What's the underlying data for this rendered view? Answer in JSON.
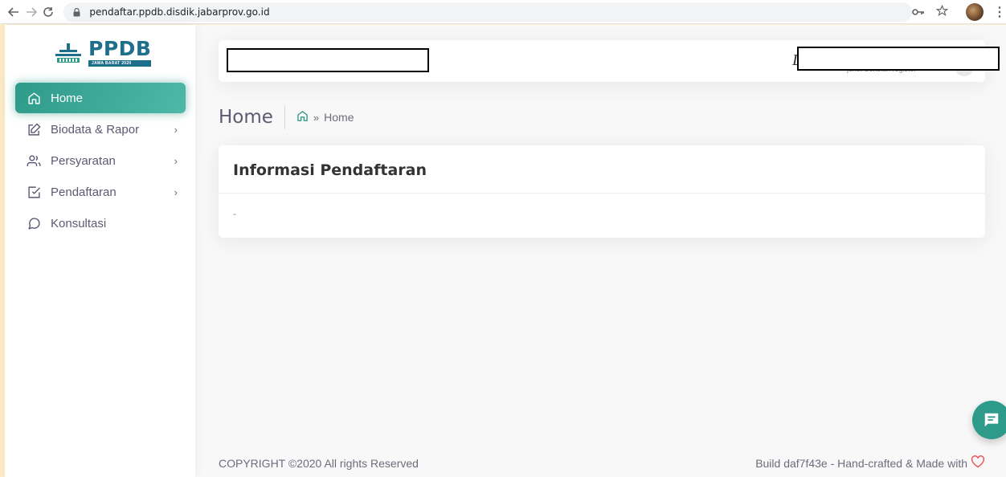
{
  "browser": {
    "url": "pendaftar.ppdb.disdik.jabarprov.go.id",
    "back_icon": "arrow-left",
    "forward_icon": "arrow-right",
    "reload_icon": "reload",
    "key_icon": "key",
    "star_icon": "star",
    "menu_icon": "kebab"
  },
  "logo": {
    "word": "PPDB",
    "badge": "JAWA BARAT 2020"
  },
  "sidebar": {
    "items": [
      {
        "label": "Home",
        "icon": "home-icon",
        "active": true,
        "has_chevron": false
      },
      {
        "label": "Biodata & Rapor",
        "icon": "edit-icon",
        "active": false,
        "has_chevron": true
      },
      {
        "label": "Persyaratan",
        "icon": "users-icon",
        "active": false,
        "has_chevron": true
      },
      {
        "label": "Pendaftaran",
        "icon": "check-square-icon",
        "active": false,
        "has_chevron": true
      },
      {
        "label": "Konsultasi",
        "icon": "message-circle-icon",
        "active": false,
        "has_chevron": false
      }
    ]
  },
  "navbar": {
    "name_initial": "L",
    "role": "jurist Sekolah register"
  },
  "page": {
    "title": "Home",
    "breadcrumb_sep": "»",
    "breadcrumb_current": "Home"
  },
  "card": {
    "title": "Informasi Pendaftaran",
    "body": "-"
  },
  "footer": {
    "copyright": "COPYRIGHT ©2020 All rights Reserved",
    "build": "Build daf7f43e - Hand-crafted & Made with"
  },
  "colors": {
    "accent": "#2e9a8a",
    "brand": "#1f6f8b",
    "heart": "#ea5455"
  }
}
